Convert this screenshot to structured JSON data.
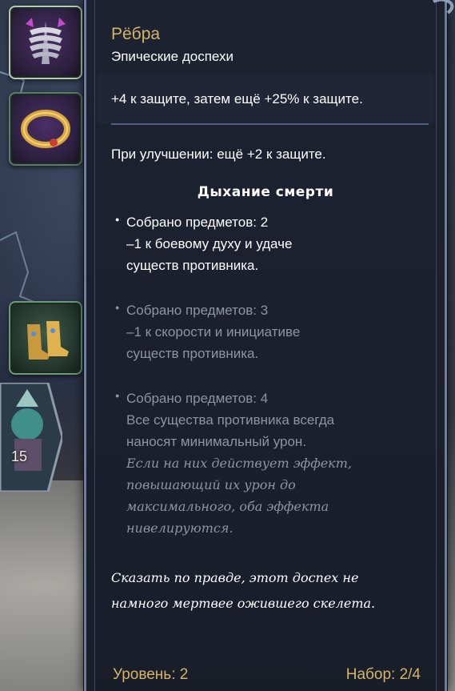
{
  "item": {
    "name": "Рёбра",
    "rarity": "Эпические доспехи",
    "main_effect": "+4 к защите, затем ещё +25% к защите.",
    "upgrade": "При улучшении: ещё +2 к защите."
  },
  "set": {
    "name": "Дыхание смерти",
    "bonuses": [
      {
        "header": "Собрано предметов: 2",
        "lines": [
          "–1 к боевому духу и удаче",
          "существ противника."
        ],
        "note": [],
        "active": true
      },
      {
        "header": "Собрано предметов: 3",
        "lines": [
          "–1 к скорости и инициативе",
          "существ противника."
        ],
        "note": [],
        "active": false
      },
      {
        "header": "Собрано предметов: 4",
        "lines": [
          "Все существа противника всегда",
          "наносят минимальный урон."
        ],
        "note": [
          "Если на них действует эффект,",
          "повышающий их урон до",
          "максимального, оба эффекта",
          "нивелируются."
        ],
        "active": false
      }
    ]
  },
  "flavor": [
    "Сказать по правде, этот доспех не",
    "намного мертвее ожившего скелета."
  ],
  "footer": {
    "level": "Уровень: 2",
    "set_count": "Набор: 2/4"
  },
  "hero": {
    "level": "15"
  },
  "inventory": [
    {
      "icon": "ribs-armor-icon"
    },
    {
      "icon": "golden-ring-icon"
    },
    {
      "icon": "golden-boots-icon"
    }
  ],
  "colors": {
    "gold": "#d4b568",
    "panel": "#1d2231",
    "border": "#6b7f9c",
    "inactive_text": "#8f94a2"
  }
}
